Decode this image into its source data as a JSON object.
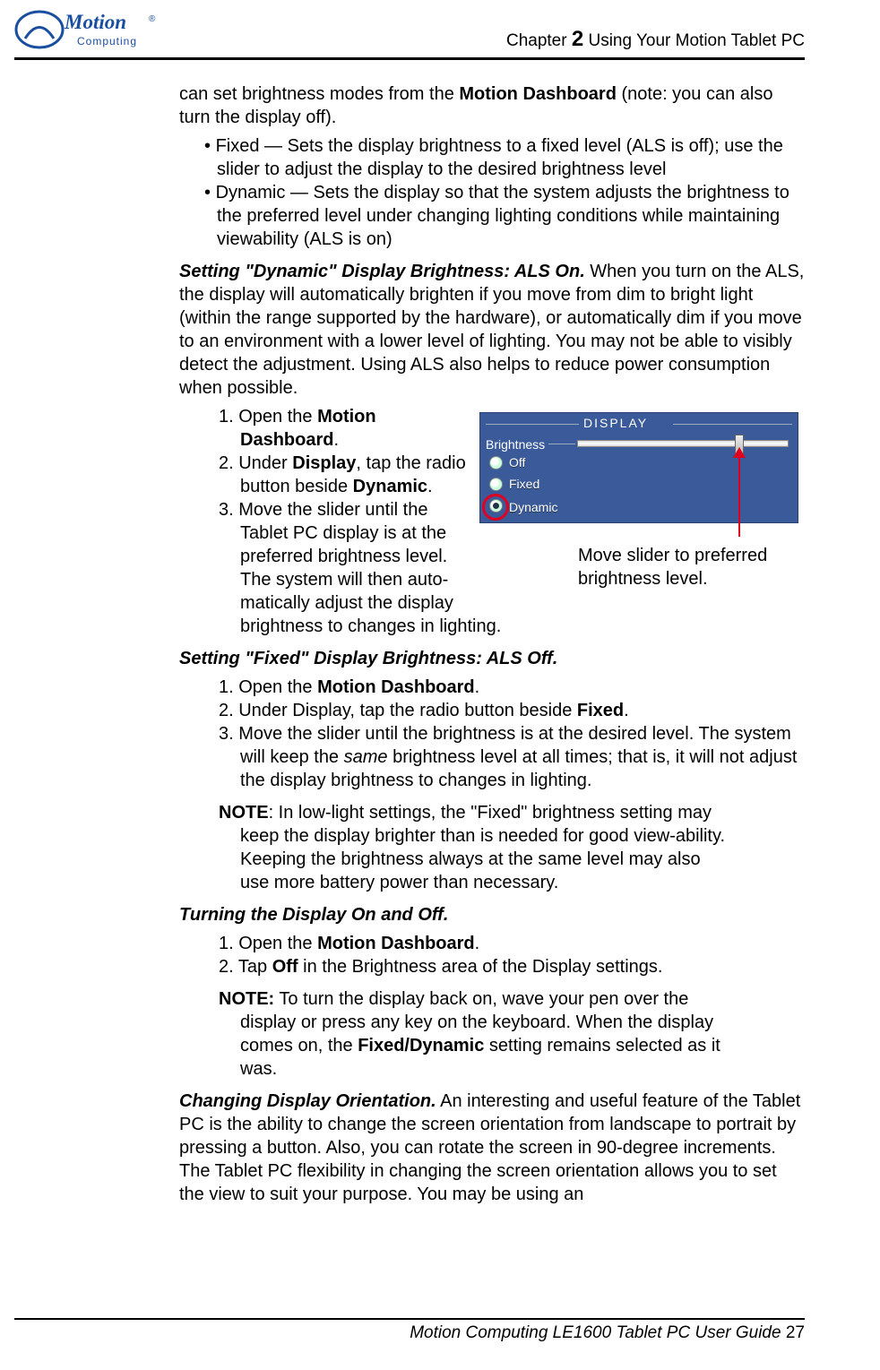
{
  "header": {
    "chapter_label": "Chapter ",
    "chapter_number": "2",
    "chapter_title": "  Using Your Motion Tablet PC",
    "logo_text_top": "Motion",
    "logo_text_bottom": "Computing",
    "logo_reg": "®"
  },
  "intro": {
    "part1": "can set brightness modes from the ",
    "bold1": "Motion Dashboard",
    "part2": " (note: you can also turn the display off)."
  },
  "bullets": {
    "b1": "Fixed — Sets the display brightness to a fixed level (ALS is off); use the slider to adjust the display to the desired brightness level",
    "b2": "Dynamic — Sets the display so that the system adjusts the brightness to the preferred level under changing lighting conditions while maintaining viewability (ALS is on)"
  },
  "dyn_section": {
    "head": "Setting \"Dynamic\" Display Brightness: ALS On.",
    "body": " When you turn on the ALS, the display will automatically brighten if you move from dim to bright light (within the range supported by the hardware), or automatically dim if you move to an environment with a lower level of lighting. You may not be able to visibly detect the adjustment. Using ALS also helps to reduce power consumption when possible."
  },
  "dyn_steps": {
    "s1a": "1. Open the ",
    "s1b": "Motion Dashboard",
    "s1c": ".",
    "s2a": "2. Under ",
    "s2b": "Display",
    "s2c": ", tap the radio button beside ",
    "s2d": "Dynamic",
    "s2e": ".",
    "s3": "3. Move the slider until the Tablet PC display is at the preferred brightness level. The system will then auto-matically adjust the display brightness to changes in lighting."
  },
  "figure": {
    "panel_title": "DISPLAY",
    "brightness_label": "Brightness",
    "r_off": "Off",
    "r_fixed": "Fixed",
    "r_dynamic": "Dynamic",
    "cap1": "Move slider to preferred brightness level."
  },
  "fixed_section": {
    "head": "Setting \"Fixed\" Display Brightness: ALS Off."
  },
  "fixed_steps": {
    "s1a": "1. Open the ",
    "s1b": "Motion Dashboard",
    "s1c": ".",
    "s2a": "2. Under Display, tap the radio button beside ",
    "s2b": "Fixed",
    "s2c": ".",
    "s3a": "3. Move the slider until the brightness is at the desired level. The system will keep the ",
    "s3b": "same",
    "s3c": " brightness level at all times; that is, it will not adjust the display brightness to changes in lighting."
  },
  "fixed_note": {
    "lead": "NOTE",
    "body": ": In low-light settings, the \"Fixed\" brightness setting may keep the display brighter than is needed for good view-ability. Keeping the brightness always at the same level may also use more battery power than necessary."
  },
  "onoff_section": {
    "head": "Turning the Display On and Off."
  },
  "onoff_steps": {
    "s1a": "1. Open the ",
    "s1b": "Motion Dashboard",
    "s1c": ".",
    "s2a": "2. Tap ",
    "s2b": "Off",
    "s2c": " in the Brightness area of the Display settings."
  },
  "onoff_note": {
    "lead": "NOTE:",
    "body1": " To turn the display back on, wave your pen over the display or press any key on the keyboard. When the display comes on, the ",
    "bold": "Fixed/Dynamic",
    "body2": " setting remains selected as it was."
  },
  "orient_section": {
    "head": "Changing Display Orientation.",
    "body": " An interesting and useful feature of the Tablet PC is the ability to change the screen orientation from landscape to portrait by pressing a button. Also, you can rotate the screen in 90-degree increments. The Tablet PC flexibility in changing the screen orientation allows you to set the view to suit your purpose. You may be using an"
  },
  "footer": {
    "guide": "Motion Computing LE1600 Tablet PC User Guide",
    "page": " 27"
  }
}
